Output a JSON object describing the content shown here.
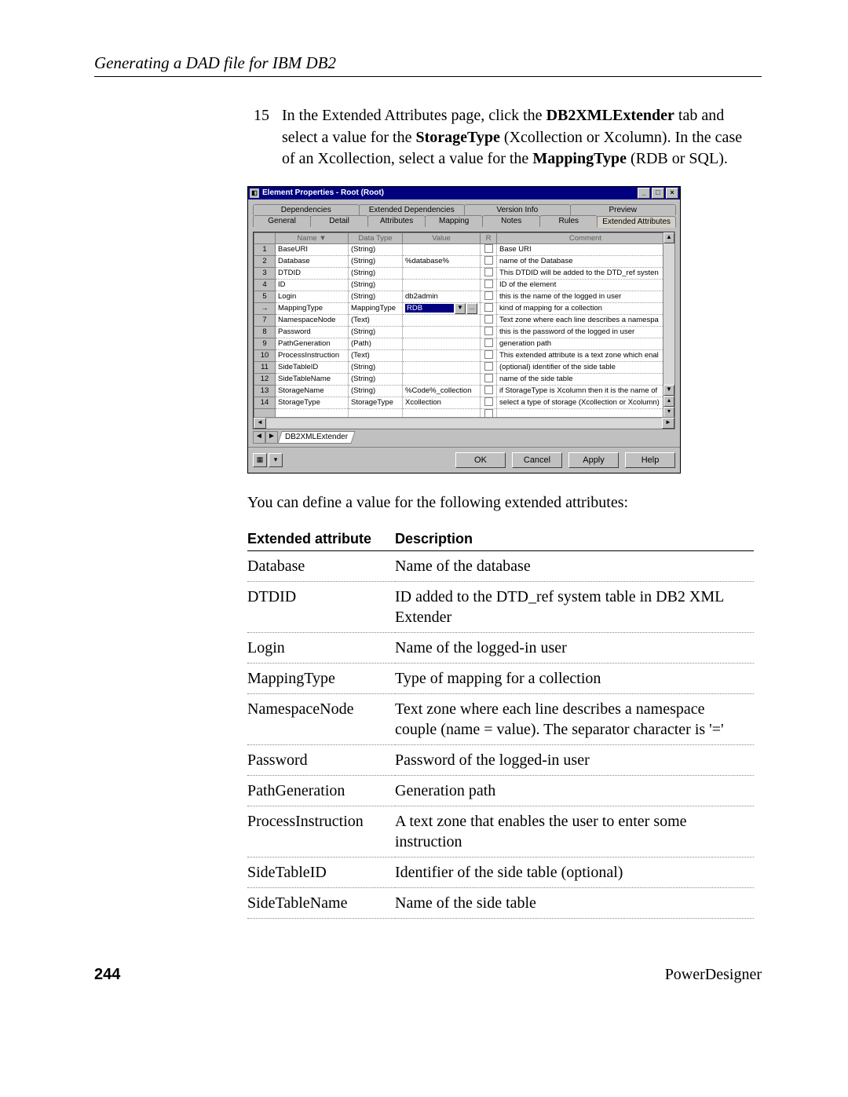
{
  "running_head": "Generating a DAD file for IBM DB2",
  "step": {
    "num": "15",
    "text_parts": {
      "p1": "In the Extended Attributes page, click the ",
      "b1": "DB2XMLExtender",
      "p2": " tab and select a value for the ",
      "b2": "StorageType",
      "p3": " (Xcollection or Xcolumn). In the case of an Xcollection, select a value for the ",
      "b3": "MappingType",
      "p4": " (RDB or SQL)."
    }
  },
  "dialog": {
    "title": "Element Properties - Root (Root)",
    "win_buttons": {
      "min": "_",
      "max": "□",
      "close": "×"
    },
    "tabs_back": [
      "Dependencies",
      "Extended Dependencies",
      "Version Info",
      "Preview"
    ],
    "tabs_front": [
      "General",
      "Detail",
      "Attributes",
      "Mapping",
      "Notes",
      "Rules",
      "Extended Attributes"
    ],
    "active_front_tab_index": 6,
    "grid_headers": {
      "rownum": "",
      "name": "Name",
      "name_arrow": "▼",
      "datatype": "Data Type",
      "value": "Value",
      "r": "R",
      "comment": "Comment"
    },
    "rows": [
      {
        "n": "1",
        "name": "BaseURI",
        "type": "(String)",
        "value": "",
        "comment": "Base URI"
      },
      {
        "n": "2",
        "name": "Database",
        "type": "(String)",
        "value": "%database%",
        "comment": "name of the Database"
      },
      {
        "n": "3",
        "name": "DTDID",
        "type": "(String)",
        "value": "",
        "comment": "This DTDID will be added to the DTD_ref systen"
      },
      {
        "n": "4",
        "name": "ID",
        "type": "(String)",
        "value": "",
        "comment": "ID of the element"
      },
      {
        "n": "5",
        "name": "Login",
        "type": "(String)",
        "value": "db2admin",
        "comment": "this is the name of the logged in user"
      },
      {
        "n": "→",
        "name": "MappingType",
        "type": "MappingType",
        "value": "RDB",
        "dropdown": true,
        "comment": "kind of mapping for a collection"
      },
      {
        "n": "7",
        "name": "NamespaceNode",
        "type": "(Text)",
        "value": "",
        "comment": "Text zone where each line describes a namespa"
      },
      {
        "n": "8",
        "name": "Password",
        "type": "(String)",
        "value": "",
        "comment": "this is the password of the logged in user"
      },
      {
        "n": "9",
        "name": "PathGeneration",
        "type": "(Path)",
        "value": "",
        "comment": "generation path"
      },
      {
        "n": "10",
        "name": "ProcessInstruction",
        "type": "(Text)",
        "value": "",
        "comment": "This extended attribute is a text zone which enal"
      },
      {
        "n": "11",
        "name": "SideTableID",
        "type": "(String)",
        "value": "",
        "comment": "(optional) identifier of the side table"
      },
      {
        "n": "12",
        "name": "SideTableName",
        "type": "(String)",
        "value": "",
        "comment": "name of the side table"
      },
      {
        "n": "13",
        "name": "StorageName",
        "type": "(String)",
        "value": "%Code%_collection",
        "comment": "if StorageType is Xcolumn then it is the name of"
      },
      {
        "n": "14",
        "name": "StorageType",
        "type": "StorageType",
        "value": "Xcollection",
        "comment": "select a type of storage (Xcollection or Xcolumn)"
      }
    ],
    "empty_rows": 3,
    "sheet_tab": "DB2XMLExtender",
    "buttons": {
      "ok": "OK",
      "cancel": "Cancel",
      "apply": "Apply",
      "help": "Help"
    }
  },
  "post_para": "You can define a value for the following extended attributes:",
  "ext_table": {
    "headers": {
      "attr": "Extended attribute",
      "desc": "Description"
    },
    "rows": [
      {
        "attr": "Database",
        "desc": "Name of the database"
      },
      {
        "attr": "DTDID",
        "desc": "ID added to the DTD_ref system table in DB2 XML Extender"
      },
      {
        "attr": "Login",
        "desc": "Name of the logged-in user"
      },
      {
        "attr": "MappingType",
        "desc": "Type of mapping for a collection"
      },
      {
        "attr": "NamespaceNode",
        "desc": "Text zone where each line describes a namespace couple (name = value). The separator character is '='"
      },
      {
        "attr": "Password",
        "desc": "Password of the logged-in user"
      },
      {
        "attr": "PathGeneration",
        "desc": "Generation path"
      },
      {
        "attr": "ProcessInstruction",
        "desc": "A text zone that enables the user to enter some instruction"
      },
      {
        "attr": "SideTableID",
        "desc": "Identifier of the side table (optional)"
      },
      {
        "attr": "SideTableName",
        "desc": "Name of the side table"
      }
    ]
  },
  "footer": {
    "page": "244",
    "product": "PowerDesigner"
  }
}
